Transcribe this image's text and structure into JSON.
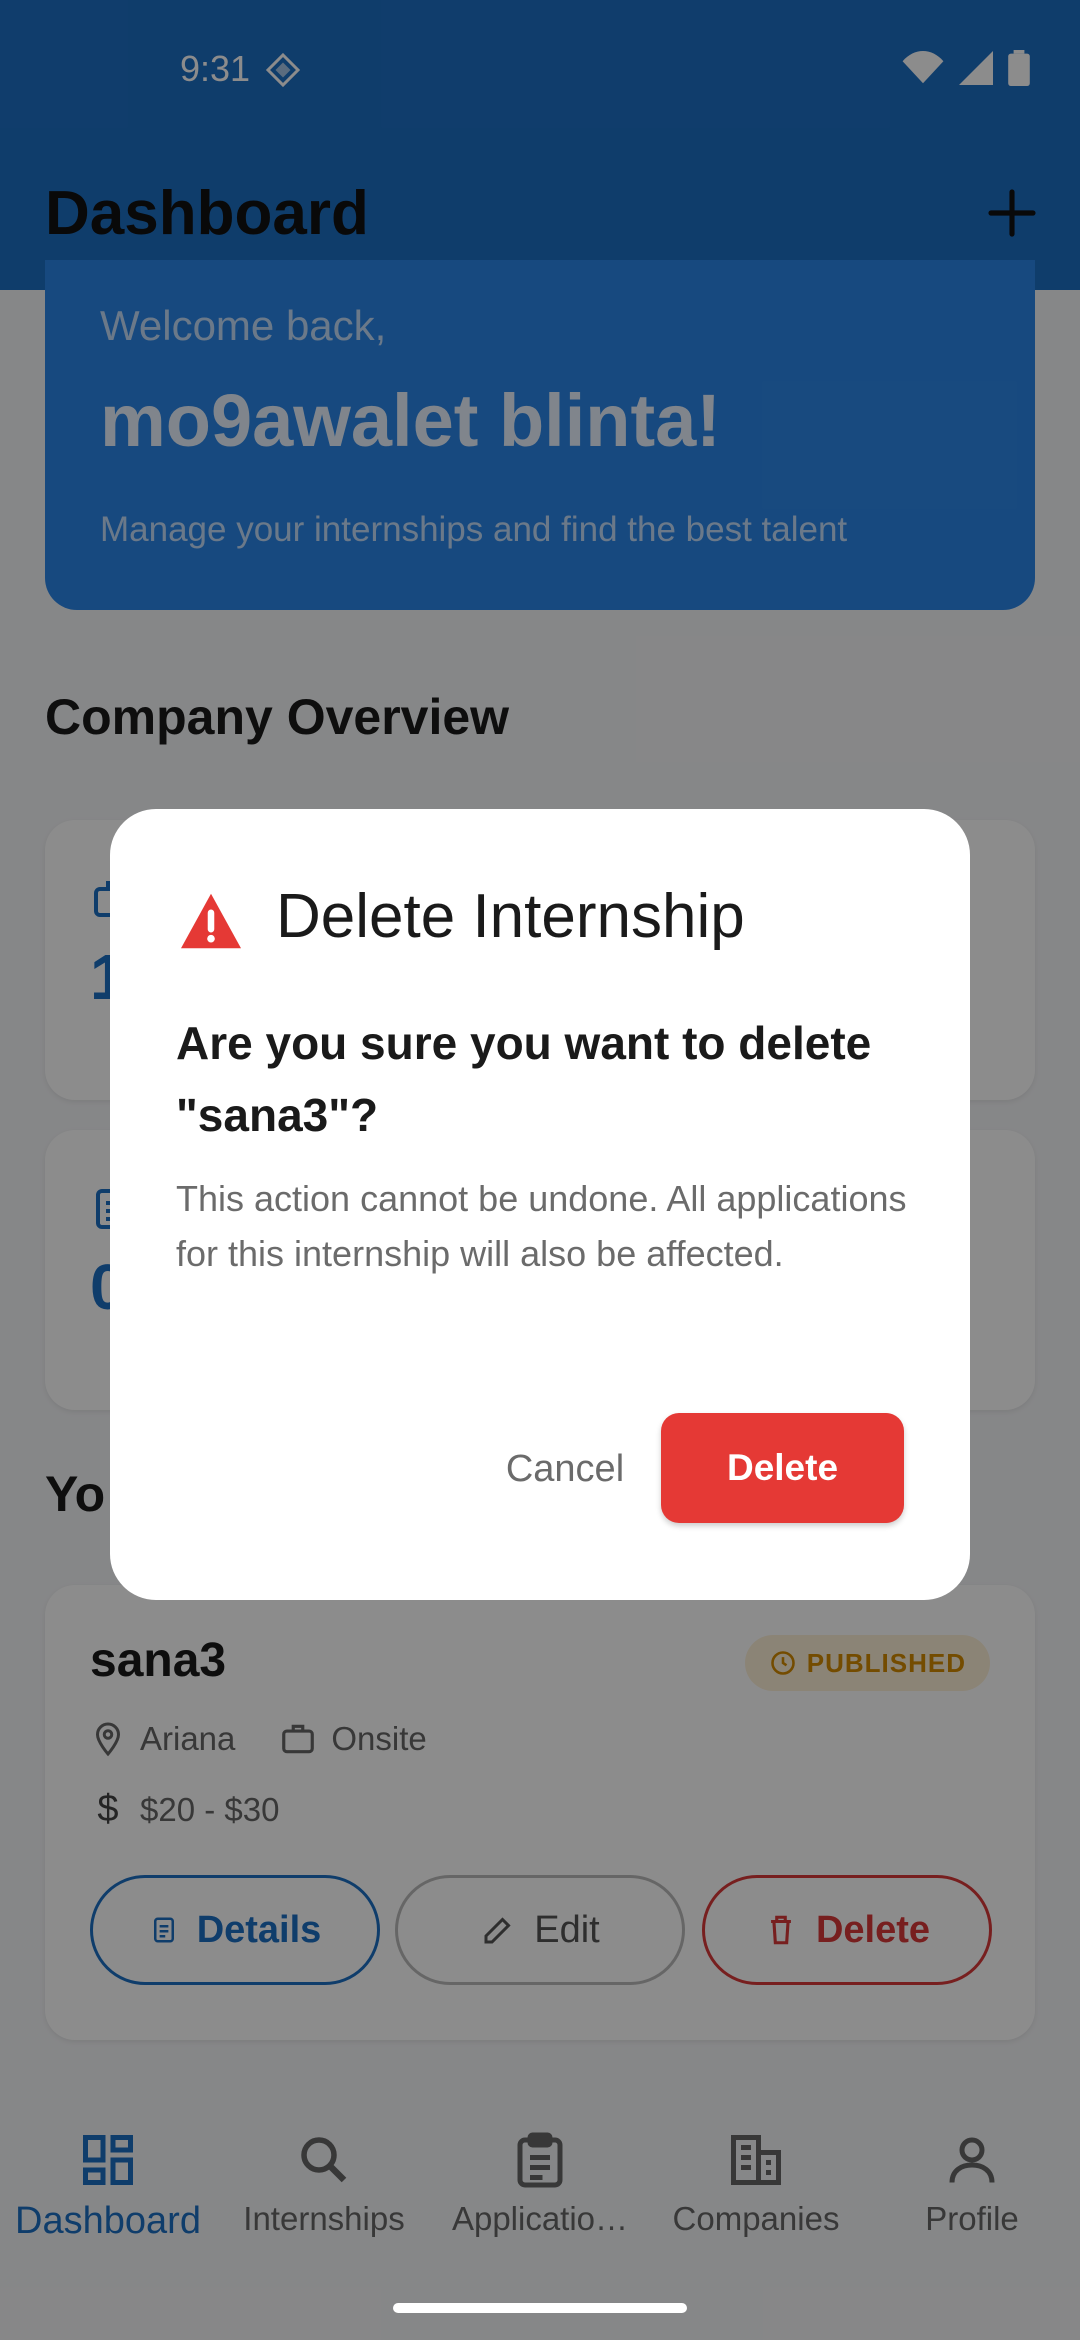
{
  "status_bar": {
    "time": "9:31"
  },
  "header": {
    "title": "Dashboard"
  },
  "welcome": {
    "greeting": "Welcome back,",
    "name": "mo9awalet blinta!",
    "subtitle": "Manage your internships and find the best talent"
  },
  "company_overview": {
    "title": "Company Overview",
    "stats": [
      {
        "value": "1",
        "icon": "briefcase-icon"
      },
      {
        "value": "0",
        "icon": "document-icon"
      }
    ]
  },
  "internships_section": {
    "title_partial": "Yo"
  },
  "internship": {
    "title": "sana3",
    "status": "PUBLISHED",
    "location": "Ariana",
    "work_type": "Onsite",
    "salary": "$20 - $30",
    "buttons": {
      "details": "Details",
      "edit": "Edit",
      "delete": "Delete"
    }
  },
  "bottom_nav": {
    "items": [
      {
        "label": "Dashboard",
        "icon": "dashboard-icon",
        "active": true
      },
      {
        "label": "Internships",
        "icon": "search-icon"
      },
      {
        "label": "Applicatio…",
        "icon": "clipboard-icon"
      },
      {
        "label": "Companies",
        "icon": "building-icon"
      },
      {
        "label": "Profile",
        "icon": "person-icon"
      }
    ]
  },
  "dialog": {
    "title": "Delete Internship",
    "question": "Are you sure you want to delete \"sana3\"?",
    "message": "This action cannot be undone. All applications for this internship will also be affected.",
    "cancel_label": "Cancel",
    "delete_label": "Delete"
  },
  "colors": {
    "primary": "#1d6fc4",
    "danger": "#e53935",
    "published": "#d48a00"
  }
}
